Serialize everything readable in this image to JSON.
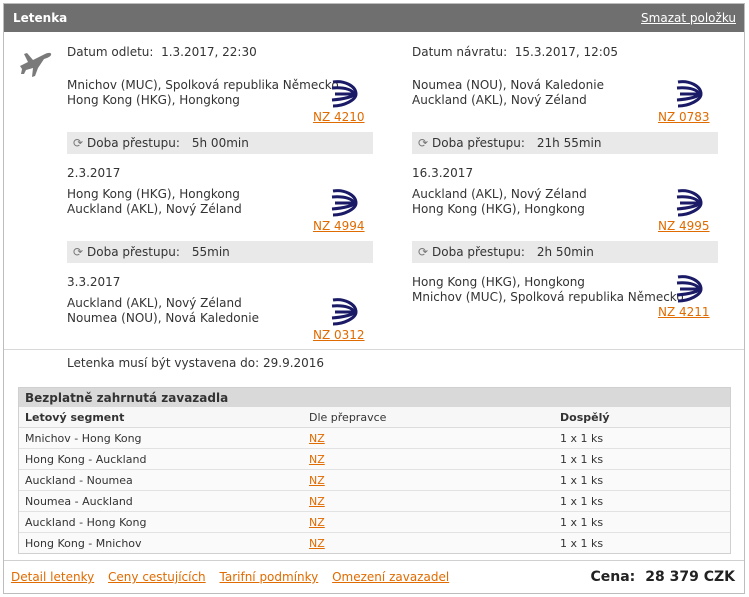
{
  "header": {
    "title": "Letenka",
    "remove_label": "Smazat položku"
  },
  "outbound": {
    "date_label": "Datum odletu:",
    "date_value": "1.3.2017, 22:30",
    "segments": [
      {
        "from": "Mnichov (MUC), Spolková republika Německo",
        "to": "Hong Kong (HKG), Hongkong",
        "flight": "NZ 4210"
      },
      {
        "date": "2.3.2017",
        "from": "Hong Kong (HKG), Hongkong",
        "to": "Auckland (AKL), Nový Zéland",
        "flight": "NZ 4994"
      },
      {
        "date": "3.3.2017",
        "from": "Auckland (AKL), Nový Zéland",
        "to": "Noumea (NOU), Nová Kaledonie",
        "flight": "NZ 0312"
      }
    ],
    "layovers": [
      {
        "label": "Doba přestupu:",
        "value": "5h 00min"
      },
      {
        "label": "Doba přestupu:",
        "value": "55min"
      }
    ]
  },
  "return": {
    "date_label": "Datum návratu:",
    "date_value": "15.3.2017, 12:05",
    "segments": [
      {
        "from": "Noumea (NOU), Nová Kaledonie",
        "to": "Auckland (AKL), Nový Zéland",
        "flight": "NZ 0783"
      },
      {
        "date": "16.3.2017",
        "from": "Auckland (AKL), Nový Zéland",
        "to": "Hong Kong (HKG), Hongkong",
        "flight": "NZ 4995"
      },
      {
        "from": "Hong Kong (HKG), Hongkong",
        "to": "Mnichov (MUC), Spolková republika Německo",
        "flight": "NZ 4211"
      }
    ],
    "layovers": [
      {
        "label": "Doba přestupu:",
        "value": "21h 55min"
      },
      {
        "label": "Doba přestupu:",
        "value": "2h 50min"
      }
    ]
  },
  "ticket_note": "Letenka musí být vystavena do: 29.9.2016",
  "baggage": {
    "title": "Bezplatně zahrnutá zavazadla",
    "columns": [
      "Letový segment",
      "Dle přepravce",
      "Dospělý"
    ],
    "rows": [
      {
        "segment": "Mnichov - Hong Kong",
        "carrier": "NZ",
        "adult": "1 x 1 ks"
      },
      {
        "segment": "Hong Kong - Auckland",
        "carrier": "NZ",
        "adult": "1 x 1 ks"
      },
      {
        "segment": "Auckland - Noumea",
        "carrier": "NZ",
        "adult": "1 x 1 ks"
      },
      {
        "segment": "Noumea - Auckland",
        "carrier": "NZ",
        "adult": "1 x 1 ks"
      },
      {
        "segment": "Auckland - Hong Kong",
        "carrier": "NZ",
        "adult": "1 x 1 ks"
      },
      {
        "segment": "Hong Kong - Mnichov",
        "carrier": "NZ",
        "adult": "1 x 1 ks"
      }
    ]
  },
  "footer": {
    "links": [
      "Detail letenky",
      "Ceny cestujících",
      "Tarifní podmínky",
      "Omezení zavazadel"
    ],
    "price_label": "Cena:",
    "price_value": "28 379 CZK"
  },
  "colors": {
    "header_bg": "#6f6f6f",
    "link": "#e06b00",
    "airline_logo": "#1a1a66"
  },
  "icons": [
    "airplane-icon",
    "air-new-zealand-logo",
    "transfer-icon"
  ]
}
